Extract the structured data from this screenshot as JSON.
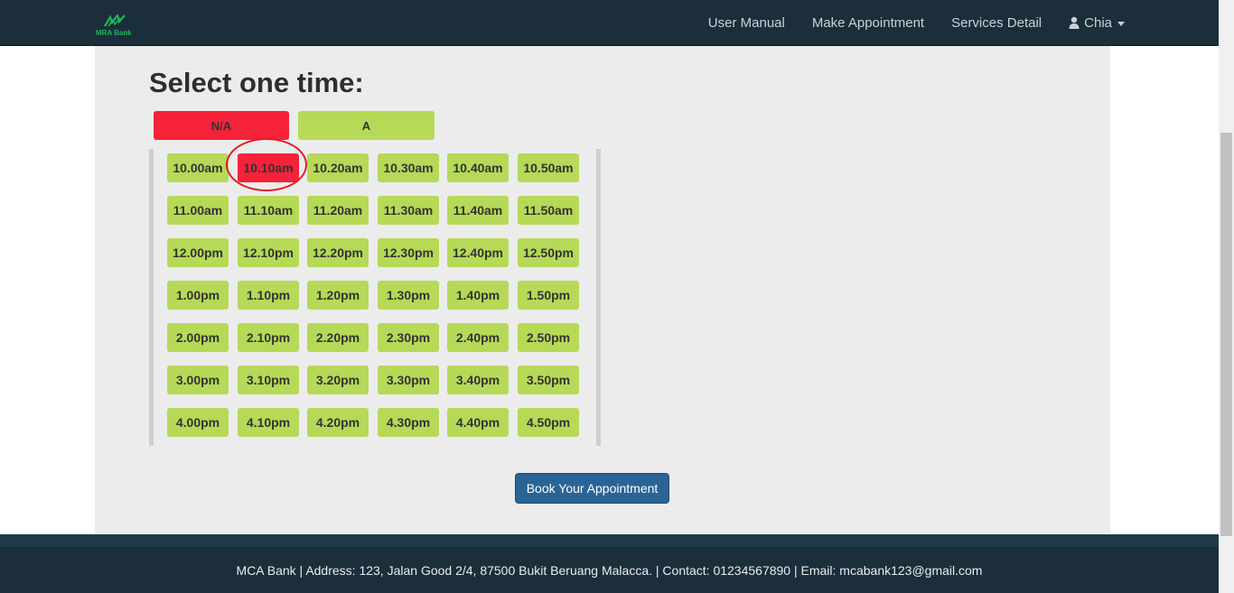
{
  "brand": {
    "name": "MRA Bank",
    "color": "#22b35b"
  },
  "nav": {
    "links": [
      "User Manual",
      "Make Appointment",
      "Services Detail"
    ],
    "user": "Chia"
  },
  "page_title": "Select one time:",
  "legend": {
    "unavailable": "N/A",
    "available": "A"
  },
  "colors": {
    "unavailable": "#f5223a",
    "available": "#b6d957",
    "navbar": "#1b2e3a",
    "button": "#2a6496"
  },
  "time_slots": [
    [
      "10.00am",
      "10.10am",
      "10.20am",
      "10.30am",
      "10.40am",
      "10.50am"
    ],
    [
      "11.00am",
      "11.10am",
      "11.20am",
      "11.30am",
      "11.40am",
      "11.50am"
    ],
    [
      "12.00pm",
      "12.10pm",
      "12.20pm",
      "12.30pm",
      "12.40pm",
      "12.50pm"
    ],
    [
      "1.00pm",
      "1.10pm",
      "1.20pm",
      "1.30pm",
      "1.40pm",
      "1.50pm"
    ],
    [
      "2.00pm",
      "2.10pm",
      "2.20pm",
      "2.30pm",
      "2.40pm",
      "2.50pm"
    ],
    [
      "3.00pm",
      "3.10pm",
      "3.20pm",
      "3.30pm",
      "3.40pm",
      "3.50pm"
    ],
    [
      "4.00pm",
      "4.10pm",
      "4.20pm",
      "4.30pm",
      "4.40pm",
      "4.50pm"
    ]
  ],
  "unavailable_slots": [
    "10.10am"
  ],
  "book_button": "Book Your Appointment",
  "footer": "MCA Bank | Address: 123, Jalan Good 2/4, 87500 Bukit Beruang Malacca. | Contact: 01234567890 | Email: mcabank123@gmail.com"
}
